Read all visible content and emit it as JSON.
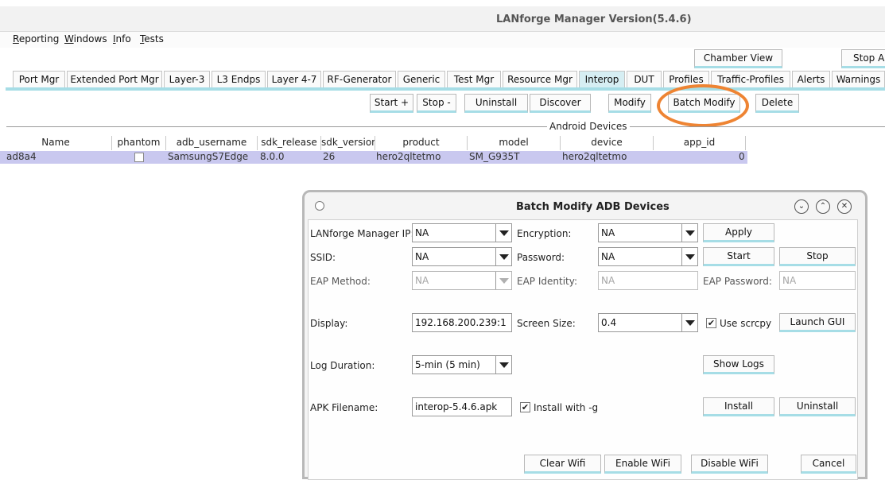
{
  "window": {
    "title": "LANforge Manager   Version(5.4.6)"
  },
  "menu": [
    "Reporting",
    "Windows",
    "Info",
    "Tests"
  ],
  "top_buttons": {
    "chamber_view": "Chamber View",
    "stop_all": "Stop All"
  },
  "tabs": [
    "Port Mgr",
    "Extended Port Mgr",
    "Layer-3",
    "L3 Endps",
    "Layer 4-7",
    "RF-Generator",
    "Generic",
    "Test Mgr",
    "Resource Mgr",
    "Interop",
    "DUT",
    "Profiles",
    "Traffic-Profiles",
    "Alerts",
    "Warnings"
  ],
  "active_tab": "Interop",
  "toolbar": {
    "start": "Start +",
    "stop": "Stop -",
    "uninstall": "Uninstall",
    "discover": "Discover",
    "modify": "Modify",
    "batch_modify": "Batch Modify",
    "delete": "Delete"
  },
  "section": {
    "title": "Android Devices"
  },
  "table": {
    "columns": [
      "Name",
      "phantom",
      "adb_username",
      "sdk_release",
      "sdk_version",
      "product",
      "model",
      "device",
      "app_id"
    ],
    "rows": [
      {
        "name": "ad8a4",
        "phantom": "",
        "adb_username": "SamsungS7Edge",
        "sdk_release": "8.0.0",
        "sdk_version": "26",
        "product": "hero2qltetmo",
        "model": "SM_G935T",
        "device": "hero2qltetmo",
        "app_id": "0"
      }
    ]
  },
  "dialog": {
    "title": "Batch Modify ADB Devices",
    "labels": {
      "manager_ip": "LANforge Manager IP:",
      "encryption": "Encryption:",
      "ssid": "SSID:",
      "password": "Password:",
      "eap_method": "EAP Method:",
      "eap_identity": "EAP Identity:",
      "eap_password": "EAP Password:",
      "display": "Display:",
      "screen_size": "Screen Size:",
      "log_duration": "Log Duration:",
      "apk_filename": "APK Filename:"
    },
    "values": {
      "manager_ip": "NA",
      "encryption": "NA",
      "ssid": "NA",
      "password": "NA",
      "eap_method": "NA",
      "eap_identity": "NA",
      "eap_password": "NA",
      "display": "192.168.200.239:1",
      "screen_size": "0.4",
      "log_duration": "5-min (5 min)",
      "apk_filename": "interop-5.4.6.apk"
    },
    "checks": {
      "use_scrcpy": "Use scrcpy",
      "install_with_g": "Install with -g"
    },
    "buttons": {
      "apply": "Apply",
      "start": "Start",
      "stop": "Stop",
      "launch_gui": "Launch GUI",
      "show_logs": "Show Logs",
      "install": "Install",
      "uninstall": "Uninstall",
      "clear_wifi": "Clear Wifi",
      "enable_wifi": "Enable WiFi",
      "disable_wifi": "Disable WiFi",
      "cancel": "Cancel"
    }
  },
  "colors": {
    "accent": "#a6dde6",
    "selected_row": "#c9c8ef",
    "highlight_circle": "#ee8433"
  }
}
